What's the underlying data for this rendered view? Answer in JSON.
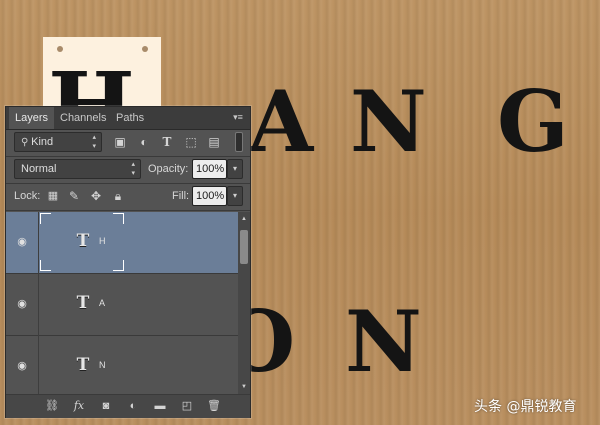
{
  "canvas": {
    "tag_text": "H",
    "row1_letters": [
      "A",
      "N",
      "G"
    ],
    "row2_letters": [
      "O",
      "N"
    ]
  },
  "watermark": "头条 @鼎锐教育",
  "panel": {
    "tabs": [
      "Layers",
      "Channels",
      "Paths"
    ],
    "filter": {
      "value": "Kind",
      "icons": [
        "image-filter-icon",
        "adjustment-filter-icon",
        "type-filter-icon",
        "shape-filter-icon",
        "smart-object-filter-icon",
        "filter-toggle-switch"
      ]
    },
    "blend_mode": "Normal",
    "opacity_label": "Opacity:",
    "opacity_value": "100%",
    "lock_label": "Lock:",
    "fill_label": "Fill:",
    "fill_value": "100%",
    "layers": [
      {
        "name": "H",
        "type": "T",
        "selected": true
      },
      {
        "name": "A",
        "type": "T",
        "selected": false
      },
      {
        "name": "N",
        "type": "T",
        "selected": false
      }
    ],
    "bottom_icons": [
      "link-icon",
      "fx-icon",
      "mask-icon",
      "adjustment-icon",
      "group-icon",
      "new-layer-icon",
      "trash-icon"
    ],
    "fx_label": "fx"
  }
}
